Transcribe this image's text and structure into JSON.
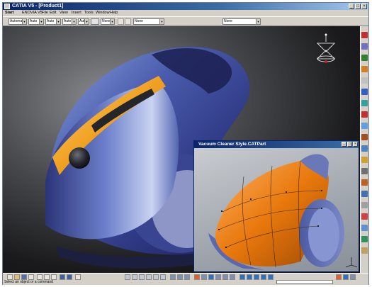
{
  "window": {
    "title": "CATIA V5 - [Product1]"
  },
  "menu": {
    "items": [
      "Start",
      "ENOVIA V5",
      "File",
      "Edit",
      "View",
      "Insert",
      "Tools",
      "Window",
      "Help"
    ]
  },
  "toolbar": {
    "combos": [
      {
        "name": "combo-1",
        "value": "Automat"
      },
      {
        "name": "combo-2",
        "value": "Auto"
      },
      {
        "name": "combo-3",
        "value": "Auto"
      },
      {
        "name": "combo-4",
        "value": "Auto"
      },
      {
        "name": "combo-5",
        "value": "Aut"
      },
      {
        "name": "combo-6",
        "value": "None"
      },
      {
        "name": "combo-7",
        "value": "None"
      },
      {
        "name": "combo-8",
        "value": "None"
      }
    ]
  },
  "subwindow": {
    "title": "Vacuum Cleaner Style.CATPart"
  },
  "colors": {
    "titlebar": "#0a246a",
    "body_blue": "#3d4f9c",
    "accent_orange": "#f0a020",
    "surface_orange": "#e8780c"
  },
  "status": {
    "prompt": "Select an object or a command"
  }
}
